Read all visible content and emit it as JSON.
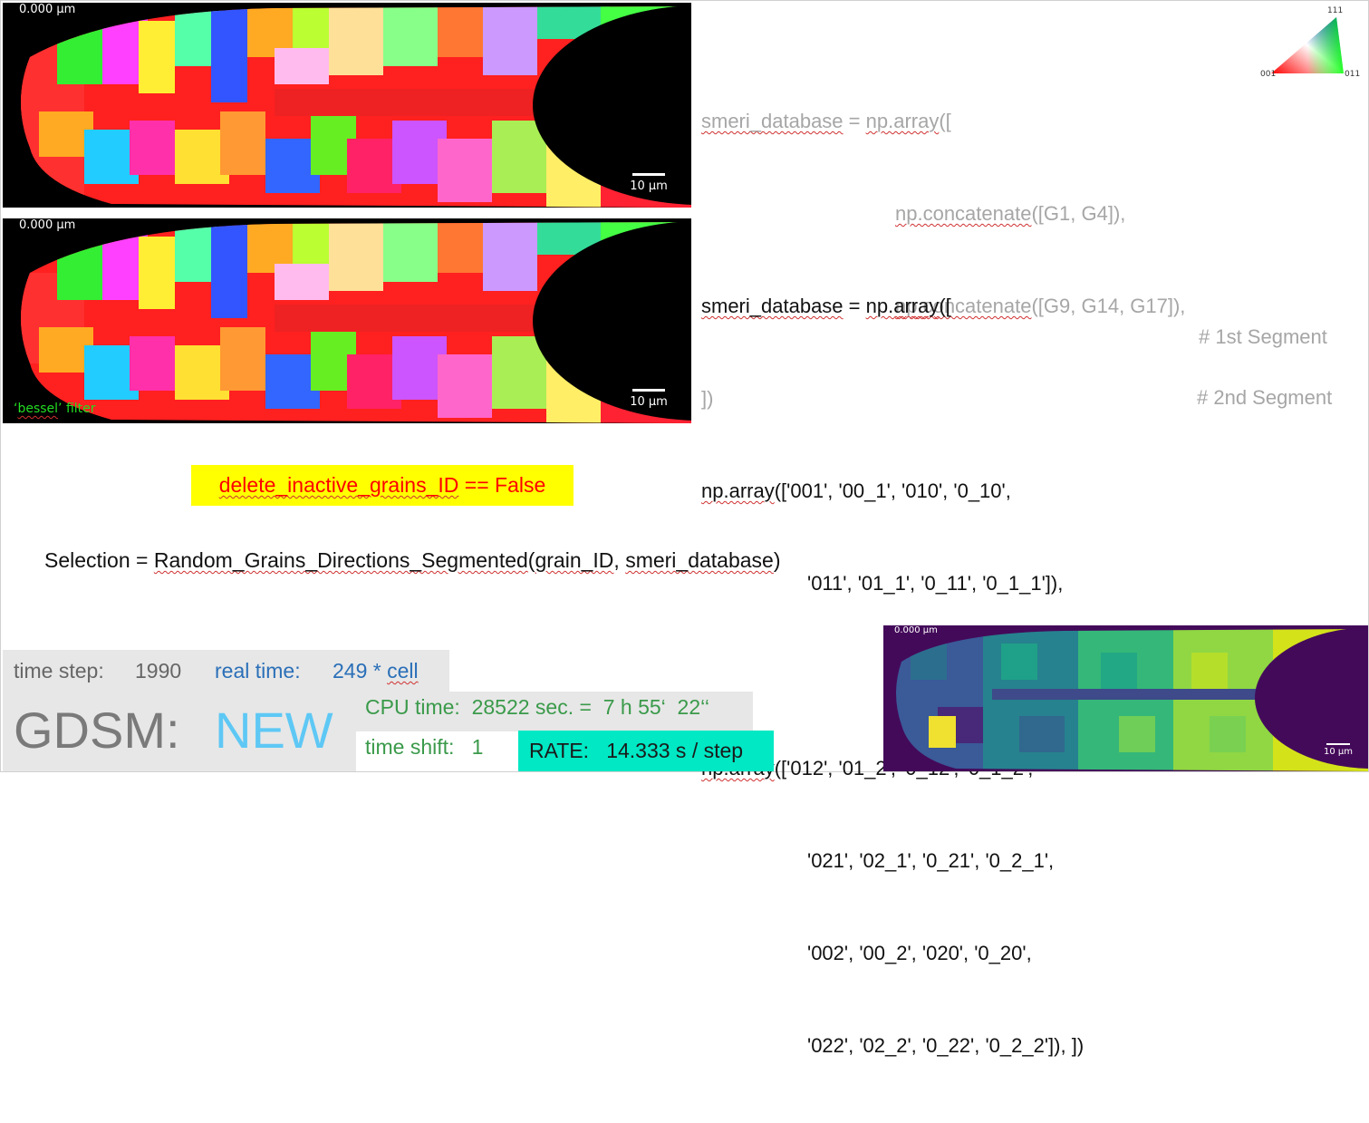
{
  "panels": {
    "top": {
      "coord": "0.000 µm",
      "scale": "10 µm"
    },
    "middle": {
      "coord": "0.000 µm",
      "scale": "10 µm",
      "filter_word": "bessel",
      "filter_label_prefix": "‘",
      "filter_label_suffix": "’ filter"
    },
    "bottom_right": {
      "coord": "0.000 µm",
      "scale": "10 µm"
    }
  },
  "ipf_legend": {
    "top": "111",
    "left": "001",
    "right": "011"
  },
  "code_gray": {
    "l1a": "smeri_database",
    "l1b": " = ",
    "l1c": "np.array",
    "l1d": "([",
    "l2a": "np.concatenate",
    "l2b": "([G1, G4]),",
    "l3a": "np.concatenate",
    "l3b": "([G9, G14, G17]),",
    "l4": "])"
  },
  "code_black": {
    "l1a": "smeri_database",
    "l1b": " = ",
    "l1c": "np.array",
    "l1d": "([",
    "l2a": "np.array",
    "l2b": "(['001', '00_1', '010', '0_10',",
    "l3": "'011', '01_1', '0_11', '0_1_1']),",
    "c1": "# 1st Segment",
    "l4a": "np.array",
    "l4b": "(['012', '01_2', '0_12', '0_1_2',",
    "c2": "# 2nd Segment",
    "l5": "'021', '02_1', '0_21', '0_2_1',",
    "l6": "'002', '00_2', '020', '0_20',",
    "l7": "'022', '02_2', '0_22', '0_2_2']), ])"
  },
  "flag": {
    "a": "delete_inactive_grains_ID",
    "b": " == False"
  },
  "selection": {
    "a": "Selection = ",
    "b": "Random_Grains_Directions_Segmented",
    "c": "(",
    "d": "grain_ID",
    "e": ", ",
    "f": "smeri_database",
    "g": ")"
  },
  "status": {
    "time_step_label": "time step:",
    "time_step_value": "1990",
    "real_time_label": "real time:",
    "real_time_value": "249 * ",
    "real_time_unit": "cell",
    "gdsm": "GDSM:",
    "mode": "NEW",
    "cpu": "CPU time:  28522 sec. =  7 h 55‘  22‘‘",
    "shift": "time shift:   1",
    "rate": "RATE:   14.333 s / step"
  },
  "colors": {
    "highlight_yellow": "#ffff00",
    "flag_text": "#ff0000",
    "rate_bg": "#00e8c4",
    "new_text": "#5ec8f5",
    "cpu_text": "#3a9a4a"
  }
}
